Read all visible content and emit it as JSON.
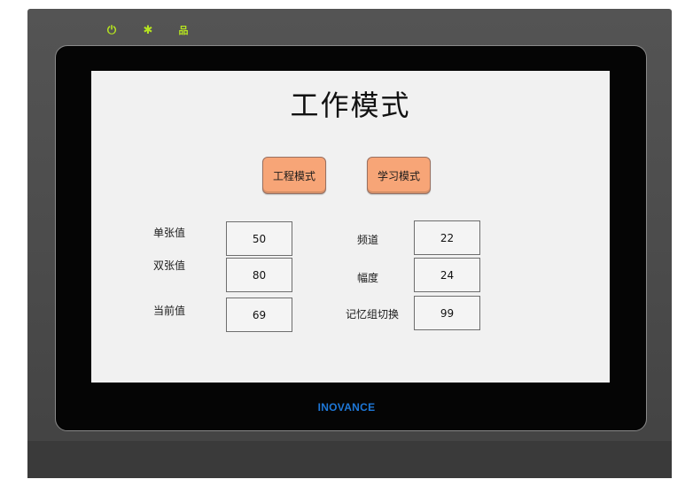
{
  "device": {
    "brand": "INOVANCE",
    "indicator_color": "#b6e51f",
    "indicators": [
      {
        "name": "power-icon",
        "glyph": "⏻"
      },
      {
        "name": "run-status-icon",
        "glyph": "✱"
      },
      {
        "name": "network-icon",
        "glyph": "品"
      }
    ]
  },
  "screen": {
    "title": "工作模式",
    "buttons": {
      "engineering_mode": "工程模式",
      "learning_mode": "学习模式"
    },
    "button_color": "#f7a577",
    "left_fields": [
      {
        "label": "单张值",
        "value": "50"
      },
      {
        "label": "双张值",
        "value": "80"
      },
      {
        "label": "当前值",
        "value": "69"
      }
    ],
    "right_fields": [
      {
        "label": "频道",
        "value": "22"
      },
      {
        "label": "幅度",
        "value": "24"
      },
      {
        "label": "记忆组切换",
        "value": "99"
      }
    ]
  }
}
